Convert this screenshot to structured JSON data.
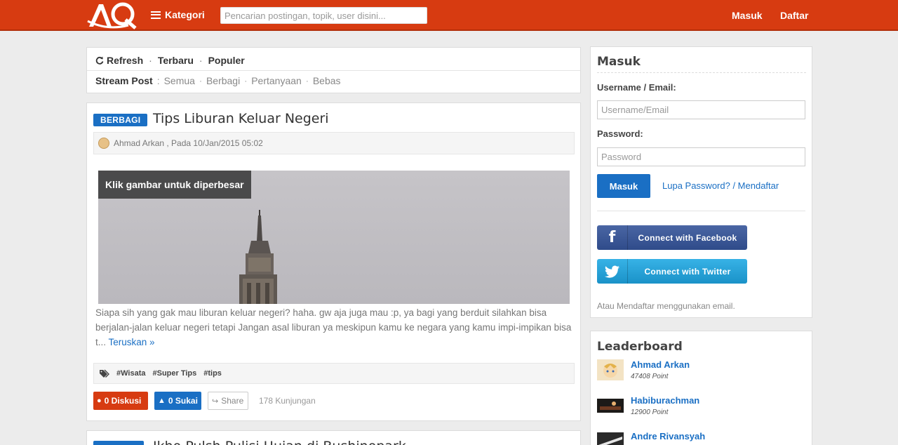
{
  "header": {
    "logo_text": "AQ",
    "kategori_label": "Kategori",
    "search_placeholder": "Pencarian postingan, topik, user disini...",
    "login_label": "Masuk",
    "register_label": "Daftar"
  },
  "filter": {
    "refresh": "Refresh",
    "terbaru": "Terbaru",
    "populer": "Populer",
    "stream_label": "Stream Post",
    "stream_items": [
      "Semua",
      "Berbagi",
      "Pertanyaan",
      "Bebas"
    ]
  },
  "post": {
    "badge": "BERBAGI",
    "title": "Tips Liburan Keluar Negeri",
    "meta": "Ahmad Arkan , Pada 10/Jan/2015 05:02",
    "image_label": "Klik gambar untuk diperbesar",
    "excerpt": "Siapa sih yang gak mau liburan keluar negeri? haha. gw aja juga mau :p, ya bagi yang berduit silahkan bisa berjalan-jalan keluar negeri tetapi Jangan asal liburan ya meskipun kamu ke negara yang kamu impi-impikan bisa t...",
    "read_more": "Teruskan »",
    "tags": [
      "#Wisata",
      "#Super Tips",
      "#tips"
    ],
    "diskusi": "0 Diskusi",
    "sukai": "0 Sukai",
    "share": "Share",
    "visits": "178 Kunjungan"
  },
  "post2": {
    "title": "Ikho Pulsh Pulisi Hujan di Bushinopark"
  },
  "login": {
    "title": "Masuk",
    "username_label": "Username / Email:",
    "username_placeholder": "Username/Email",
    "password_label": "Password:",
    "password_placeholder": "Password",
    "submit": "Masuk",
    "forgot": "Lupa Password? / Mendaftar",
    "facebook": "Connect with Facebook",
    "twitter": "Connect with Twitter",
    "alt": "Atau Mendaftar menggunakan email."
  },
  "leaderboard": {
    "title": "Leaderboard",
    "items": [
      {
        "name": "Ahmad Arkan",
        "points": "47408 Point"
      },
      {
        "name": "Habiburachman",
        "points": "12900 Point"
      },
      {
        "name": "Andre Rivansyah",
        "points": ""
      }
    ]
  },
  "colors": {
    "brand": "#d73b11",
    "accent": "#1a6fc4"
  }
}
